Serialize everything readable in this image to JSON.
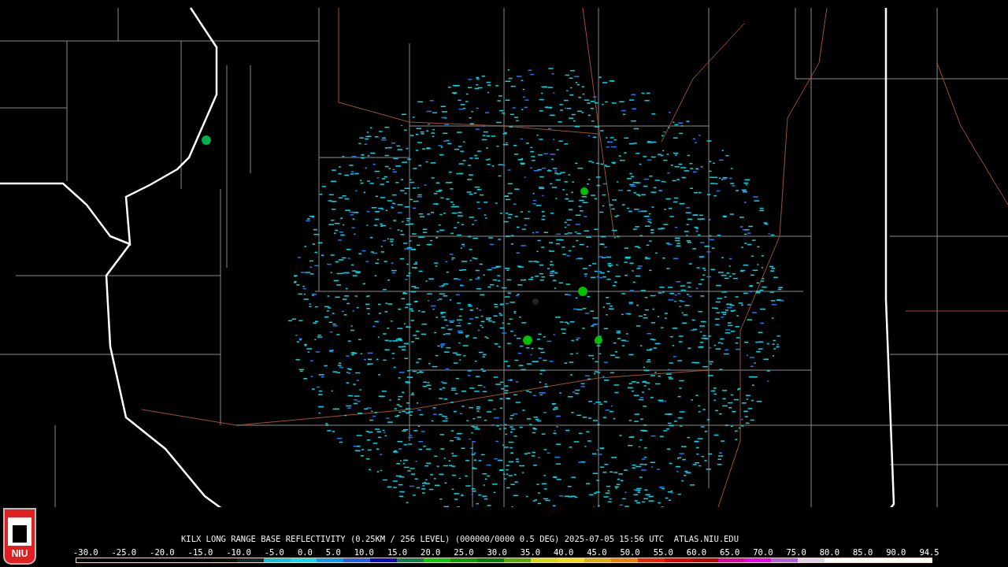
{
  "logo": {
    "text": "NIU"
  },
  "caption": "KILX LONG RANGE BASE REFLECTIVITY (0.25KM / 256 LEVEL) (000000/0000 0.5 DEG) 2025-07-05 15:56 UTC  ATLAS.NIU.EDU",
  "scale": {
    "ticks": [
      "-30.0",
      "-25.0",
      "-20.0",
      "-15.0",
      "-10.0",
      "-5.0",
      "0.0",
      "5.0",
      "10.0",
      "15.0",
      "20.0",
      "25.0",
      "30.0",
      "35.0",
      "40.0",
      "45.0",
      "50.0",
      "55.0",
      "60.0",
      "65.0",
      "70.0",
      "75.0",
      "80.0",
      "85.0",
      "90.0",
      "94.5"
    ]
  }
}
